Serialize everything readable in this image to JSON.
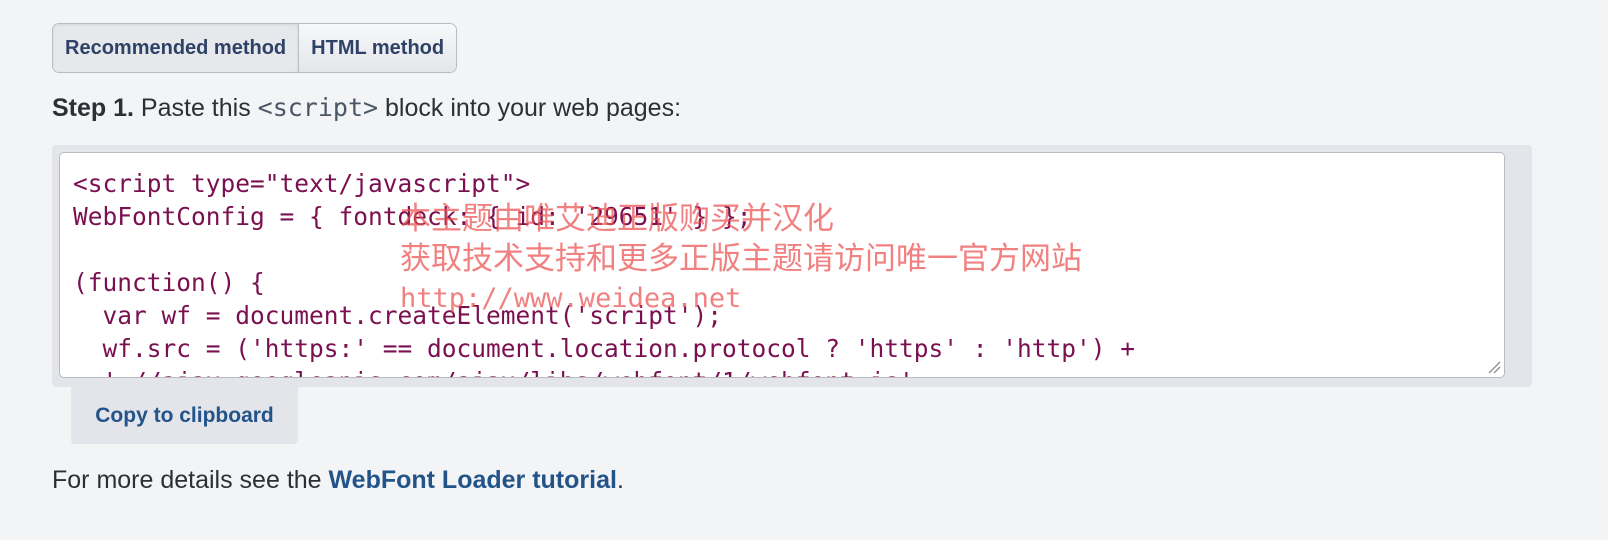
{
  "tabs": [
    {
      "label": "Recommended method",
      "active": true
    },
    {
      "label": "HTML method",
      "active": false
    }
  ],
  "step": {
    "label": "Step 1.",
    "text_before": " Paste this ",
    "code": "<script>",
    "text_after": " block into your web pages:"
  },
  "code_block": {
    "content": "<script type=\"text/javascript\">\nWebFontConfig = { fontdeck: { id: '29651' } };\n\n(function() {\n  var wf = document.createElement('script');\n  wf.src = ('https:' == document.location.protocol ? 'https' : 'http') +\n  '://ajax.googleapis.com/ajax/libs/webfont/1/webfont.js';"
  },
  "watermark": {
    "line1": "本主题由唯艾迪正版购买并汉化",
    "line2": "获取技术支持和更多正版主题请访问唯一官方网站",
    "line3": "http://www.weidea.net"
  },
  "copy_button": {
    "label": "Copy to clipboard"
  },
  "details": {
    "text_before": "For more details see the ",
    "link_text": "WebFont Loader tutorial",
    "text_after": "."
  },
  "colors": {
    "background": "#f3f4f6",
    "link": "#22548a",
    "code_text": "#7a1050",
    "watermark": "#eb5050"
  }
}
